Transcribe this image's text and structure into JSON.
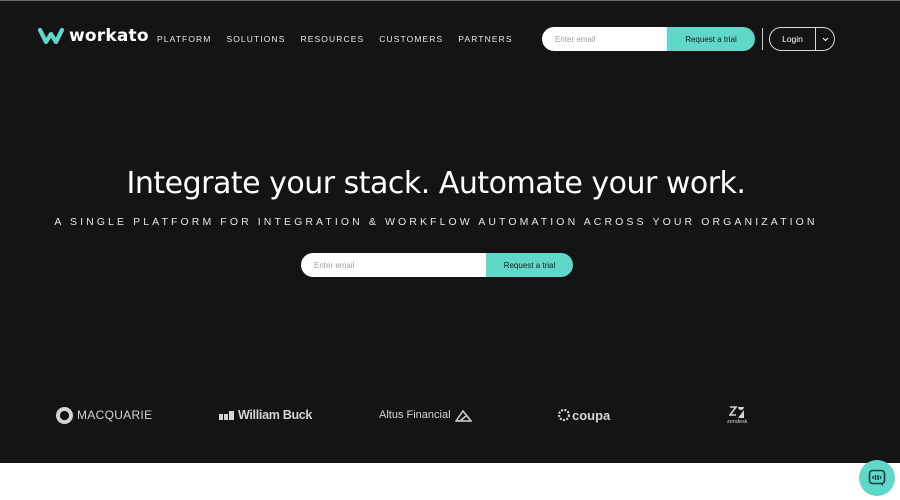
{
  "brand": {
    "name": "workato",
    "accent": "#5fd8c9",
    "background": "#141315"
  },
  "nav": {
    "items": [
      {
        "label": "PLATFORM"
      },
      {
        "label": "SOLUTIONS"
      },
      {
        "label": "RESOURCES"
      },
      {
        "label": "CUSTOMERS"
      },
      {
        "label": "PARTNERS"
      }
    ]
  },
  "header_form": {
    "placeholder": "Enter email",
    "button_label": "Request a trial"
  },
  "login": {
    "label": "Login",
    "caret_icon": "chevron-down-icon"
  },
  "hero": {
    "headline": "Integrate your stack. Automate your work.",
    "subheadline": "A SINGLE PLATFORM FOR INTEGRATION & WORKFLOW AUTOMATION ACROSS YOUR ORGANIZATION",
    "form": {
      "placeholder": "Enter email",
      "button_label": "Request a trial"
    }
  },
  "customers": {
    "macquarie": "MACQUARIE",
    "william_buck": "William Buck",
    "altus": "Altus Financial",
    "coupa": "coupa",
    "zendesk": "zendesk"
  },
  "chat": {
    "icon": "chat-icon"
  }
}
